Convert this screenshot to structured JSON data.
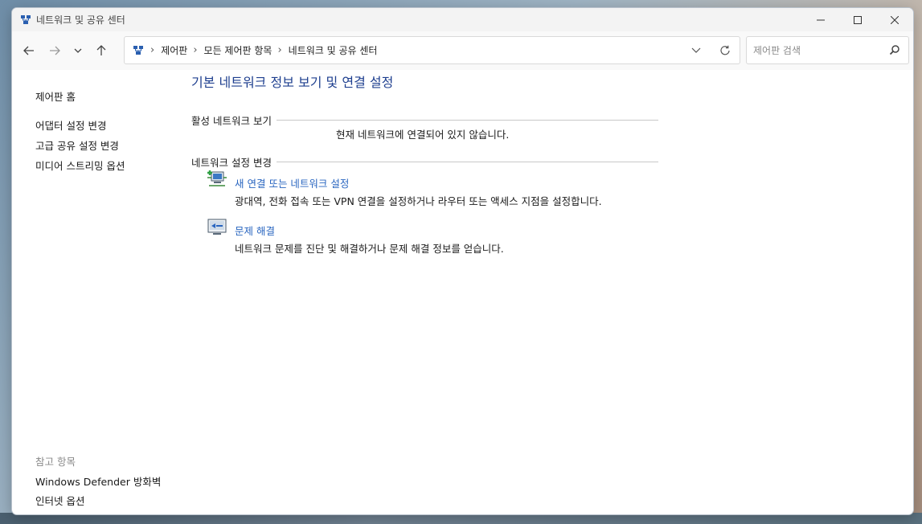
{
  "window": {
    "title": "네트워크 및 공유 센터"
  },
  "navbar": {
    "breadcrumbs": [
      "제어판",
      "모든 제어판 항목",
      "네트워크 및 공유 센터"
    ],
    "search_placeholder": "제어판 검색"
  },
  "sidebar": {
    "home_link": "제어판 홈",
    "links": [
      "어댑터 설정 변경",
      "고급 공유 설정 변경",
      "미디어 스트리밍 옵션"
    ],
    "see_also_heading": "참고 항목",
    "see_also_links": [
      "Windows Defender 방화벽",
      "인터넷 옵션"
    ]
  },
  "main": {
    "title": "기본 네트워크 정보 보기 및 연결 설정",
    "active_networks_heading": "활성 네트워크 보기",
    "not_connected_text": "현재 네트워크에 연결되어 있지 않습니다.",
    "change_settings_heading": "네트워크 설정 변경",
    "tasks": [
      {
        "icon": "new-connection-icon",
        "link": "새 연결 또는 네트워크 설정",
        "description": "광대역, 전화 접속 또는 VPN 연결을 설정하거나 라우터 또는 액세스 지점을 설정합니다."
      },
      {
        "icon": "troubleshoot-icon",
        "link": "문제 해결",
        "description": "네트워크 문제를 진단 및 해결하거나 문제 해결 정보를 얻습니다."
      }
    ]
  },
  "colors": {
    "accent_link": "#2a66c0",
    "title_blue": "#1e3f8f"
  }
}
